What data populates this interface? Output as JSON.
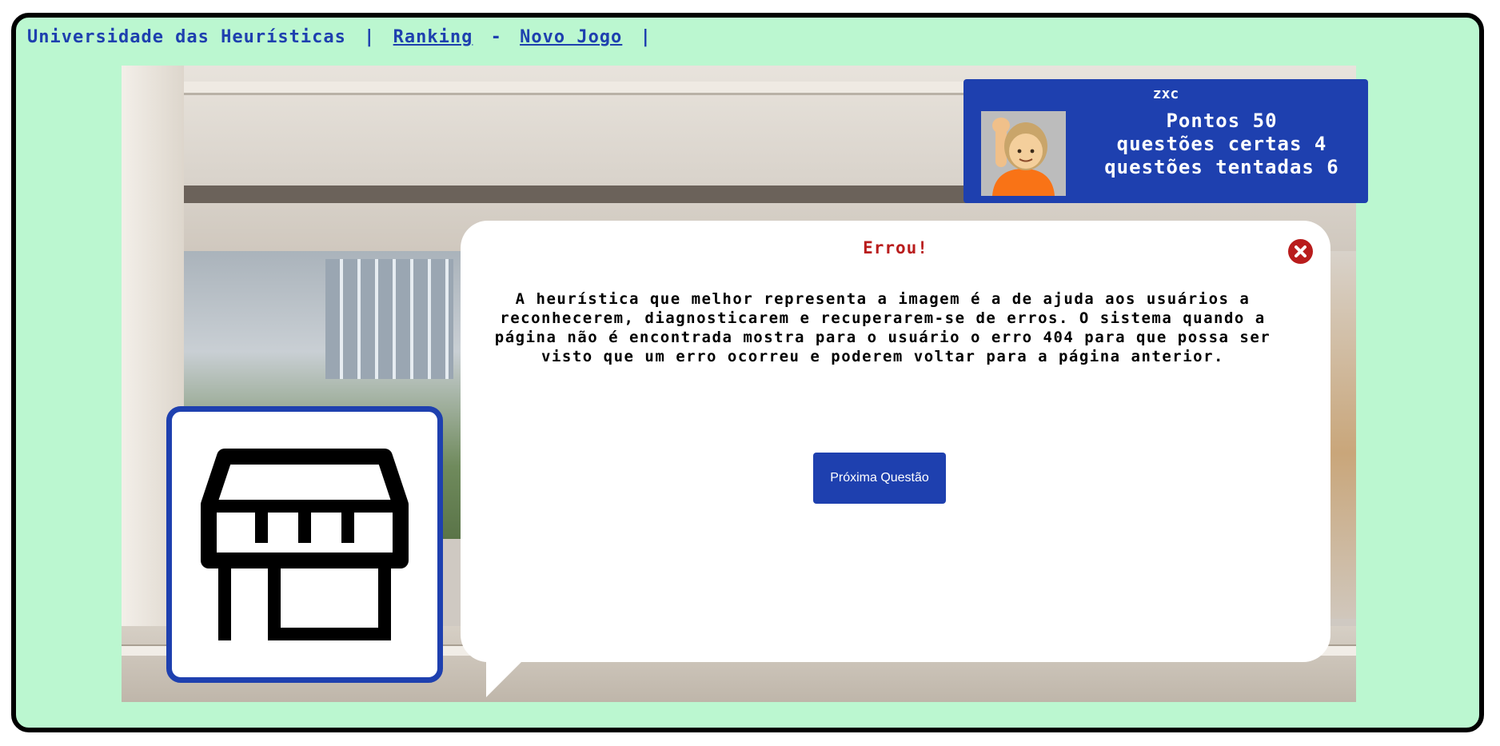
{
  "nav": {
    "site_title": "Universidade das Heurísticas",
    "separator": "|",
    "ranking_label": "Ranking",
    "dash": "-",
    "new_game_label": "Novo Jogo",
    "trailing_separator": "|"
  },
  "player": {
    "username": "zxc",
    "avatar_icon": "person-raising-hand-emoji",
    "points": "Pontos 50",
    "correct": "questões certas 4",
    "attempted": "questões tentadas 6"
  },
  "modal": {
    "title": "Errou!",
    "message": "A heurística que melhor representa a imagem é a de ajuda aos usuários a reconhecerem, diagnosticarem e recuperarem-se de erros. O sistema quando a página não é encontrada mostra para o usuário o erro 404 para que possa ser visto que um erro ocorreu e poderem voltar para a página anterior.",
    "next_button": "Próxima Questão",
    "close_icon": "close-circle-icon"
  },
  "card": {
    "icon": "storefront-icon"
  },
  "colors": {
    "background": "#bbf7d0",
    "primary": "#1e40af",
    "error": "#b91c1c"
  }
}
